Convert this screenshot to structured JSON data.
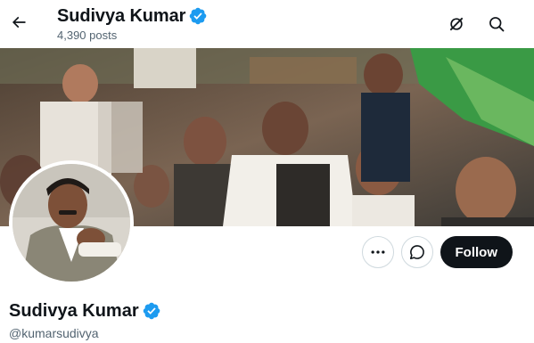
{
  "header": {
    "title": "Sudivya Kumar",
    "posts_count": "4,390 posts"
  },
  "profile": {
    "display_name": "Sudivya Kumar",
    "handle": "@kumarsudivya",
    "verified": true
  },
  "actions": {
    "follow_label": "Follow"
  },
  "icons": {
    "back": "arrow-left-icon",
    "grok": "grok-icon",
    "search": "search-icon",
    "more": "more-icon",
    "message": "message-icon",
    "verified": "verified-badge-icon"
  },
  "colors": {
    "verified_blue": "#1d9bf0",
    "follow_bg": "#0f1419",
    "secondary_text": "#536471"
  }
}
